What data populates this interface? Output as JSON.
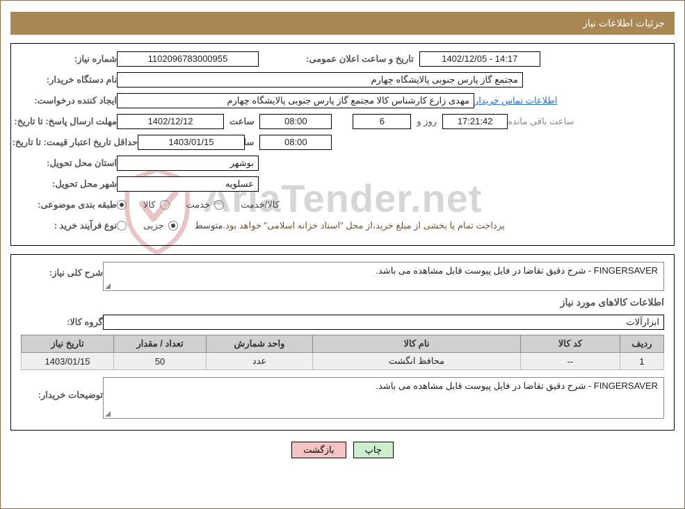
{
  "header": {
    "title": "جزئیات اطلاعات نیاز"
  },
  "info": {
    "need_number_label": "شماره نیاز:",
    "need_number": "1102096783000955",
    "announce_label": "تاریخ و ساعت اعلان عمومی:",
    "announce_value": "1402/12/05 - 14:17",
    "buyer_org_label": "نام دستگاه خریدار:",
    "buyer_org_value": "مجتمع گاز پارس جنوبی  پالایشگاه چهارم",
    "requester_label": "ایجاد کننده درخواست:",
    "requester_value": "مهدی زارع کارشناس کالا مجتمع گاز پارس جنوبی  پالایشگاه چهارم",
    "contact_link": "اطلاعات تماس خریدار",
    "reply_deadline_label": "مهلت ارسال پاسخ: تا تاریخ:",
    "reply_deadline_date": "1402/12/12",
    "time_label": "ساعت",
    "reply_deadline_time": "08:00",
    "days_remaining": "6",
    "days_and_label": "روز و",
    "time_remaining": "17:21:42",
    "remaining_label": "ساعت باقی مانده",
    "price_validity_label": "حداقل تاریخ اعتبار قیمت: تا تاریخ:",
    "price_validity_date": "1403/01/15",
    "price_validity_time": "08:00",
    "delivery_province_label": "استان محل تحویل:",
    "delivery_province": "بوشهر",
    "delivery_city_label": "شهر محل تحویل:",
    "delivery_city": "عسلویه",
    "classification_label": "طبقه بندی موضوعی:",
    "class_goods": "کالا",
    "class_service": "خدمت",
    "class_goods_service": "کالا/خدمت",
    "purchase_type_label": "نوع فرآیند خرید :",
    "purchase_partial": "جزیی",
    "purchase_medium": "متوسط",
    "purchase_note": "پرداخت تمام یا بخشی از مبلغ خرید،از محل \"اسناد خزانه اسلامی\" خواهد بود."
  },
  "details": {
    "general_desc_label": "شرح کلی نیاز:",
    "general_desc_value": "FINGERSAVER - شرح دقیق تقاضا در فایل پیوست قابل مشاهده می باشد.",
    "items_heading": "اطلاعات کالاهای مورد نیاز",
    "group_label": "گروه کالا:",
    "group_value": "ابزارآلات",
    "table": {
      "headers": {
        "row": "ردیف",
        "code": "کد کالا",
        "name": "نام کالا",
        "unit": "واحد شمارش",
        "qty": "تعداد / مقدار",
        "date": "تاریخ نیاز"
      },
      "rows": [
        {
          "row": "1",
          "code": "--",
          "name": "محافظ انگشت",
          "unit": "عدد",
          "qty": "50",
          "date": "1403/01/15"
        }
      ]
    },
    "buyer_notes_label": "توضیحات خریدار:",
    "buyer_notes_value": "FINGERSAVER - شرح دقیق تقاضا در فایل پیوست قابل مشاهده می باشد."
  },
  "buttons": {
    "print": "چاپ",
    "back": "بازگشت"
  },
  "watermark": "AriaTender.net"
}
